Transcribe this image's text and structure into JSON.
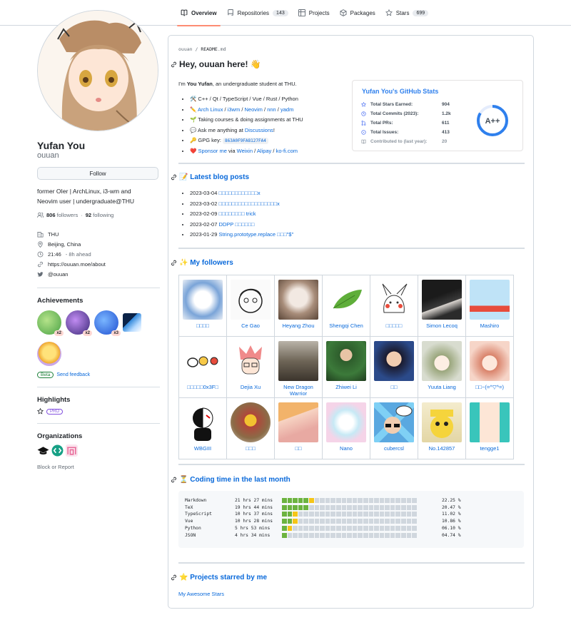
{
  "nav": {
    "tabs": [
      {
        "label": "Overview",
        "icon": "book-icon",
        "active": true
      },
      {
        "label": "Repositories",
        "icon": "repo-icon",
        "count": "143"
      },
      {
        "label": "Projects",
        "icon": "table-icon"
      },
      {
        "label": "Packages",
        "icon": "package-icon"
      },
      {
        "label": "Stars",
        "icon": "star-icon",
        "count": "699"
      }
    ]
  },
  "profile": {
    "name": "Yufan You",
    "login": "ouuan",
    "follow_label": "Follow",
    "bio_line1": "former OIer | ArchLinux, i3-wm and",
    "bio_line2": "Neovim user | undergraduate@THU",
    "followers_count": "806",
    "followers_label": "followers",
    "dot": "·",
    "following_count": "92",
    "following_label": "following",
    "org": "THU",
    "location": "Beijing, China",
    "time": "21:46",
    "time_note": "- 8h ahead",
    "website": "https://ouuan.moe/about",
    "twitter": "@ouuan"
  },
  "achievements": {
    "title": "Achievements",
    "items": [
      {
        "icon": "pair-extraordinaire-icon",
        "mult": "x2"
      },
      {
        "icon": "galaxy-brain-icon",
        "mult": "x2"
      },
      {
        "icon": "pull-shark-icon",
        "mult": "x3"
      },
      {
        "icon": "arctic-code-vault-icon",
        "mult": ""
      },
      {
        "icon": "quickdraw-icon",
        "mult": ""
      }
    ],
    "beta_label": "Beta",
    "feedback_label": "Send feedback"
  },
  "highlights": {
    "title": "Highlights",
    "pro_label": "PRO"
  },
  "organizations": {
    "title": "Organizations"
  },
  "block_label": "Block or Report",
  "readme": {
    "crumb_user": "ouuan",
    "crumb_sep": " / ",
    "crumb_file": "README",
    "crumb_ext": ".md",
    "greeting": "Hey, ouuan here! 👋",
    "intro_pre": "I'm ",
    "intro_name": "You Yufan",
    "intro_post": ", an undergraduate student at THU.",
    "bullets": {
      "langs": "🛠️ C++ / Qt / TypeScript / Vue / Rust / Python",
      "tools_prefix": "✏️",
      "tools": [
        "Arch Linux",
        "i3wm",
        "Neovim",
        "nnn",
        "yadm"
      ],
      "courses": "🌱 Taking courses & doing assignments at THU",
      "ask_pre": "💬 Ask me anything at ",
      "ask_link": "Discussions",
      "ask_post": "!",
      "gpg_label": "🔑 GPG key: ",
      "gpg_key": "863A0F9FA8127FA4",
      "sponsor_prefix": "❤️",
      "sponsor_link": "Sponsor me",
      "sponsor_via": " via ",
      "sponsor_methods": [
        "Weixin",
        "Alipay",
        "ko-fi.com"
      ]
    },
    "blog_title": "📝 Latest blog posts",
    "blog_posts": [
      {
        "date": "2023-03-04",
        "title": "□□□□□□□□□□□□x"
      },
      {
        "date": "2023-03-02",
        "title": "□□□□□□□□□□□□□□□□□□x"
      },
      {
        "date": "2023-02-09",
        "title": "□□□□□□□□ trick"
      },
      {
        "date": "2023-02-07",
        "title": "DDPP □□□□□□"
      },
      {
        "date": "2023-01-29",
        "title": "String.prototype.replace □□□\"$\""
      }
    ],
    "followers_title": "✨ My followers",
    "followers": [
      [
        "□□□□",
        "Ce Gao",
        "Heyang Zhou",
        "Shengqi Chen",
        "□□□□□",
        "Simon Lecoq",
        "Mashiro"
      ],
      [
        "□□□□□0x3F□",
        "Dejia Xu",
        "New Dragon Warrior",
        "Zhiwei Li",
        "□□",
        "Yuuta Liang",
        "□□~(=^▽^=)"
      ],
      [
        "WBGIII",
        "□□□",
        "□□",
        "Nano",
        "cubercsl",
        "No.142857",
        "tengge1"
      ]
    ],
    "coding_title": "⏳ Coding time in the last month",
    "coding": [
      {
        "lang": "Markdown",
        "time": "21 hrs 27 mins",
        "pct": "22.25 %",
        "fraction": 0.2225
      },
      {
        "lang": "TeX",
        "time": "19 hrs 44 mins",
        "pct": "20.47 %",
        "fraction": 0.2047
      },
      {
        "lang": "TypeScript",
        "time": "10 hrs 37 mins",
        "pct": "11.02 %",
        "fraction": 0.1102
      },
      {
        "lang": "Vue",
        "time": "10 hrs 28 mins",
        "pct": "10.86 %",
        "fraction": 0.1086
      },
      {
        "lang": "Python",
        "time": "5 hrs 53 mins",
        "pct": "06.10 %",
        "fraction": 0.061
      },
      {
        "lang": "JSON",
        "time": "4 hrs 34 mins",
        "pct": "04.74 %",
        "fraction": 0.0474
      }
    ],
    "starred_title": "⭐ Projects starred by me",
    "starred_link": "My Awesome Stars"
  },
  "stats_card": {
    "title": "Yufan You's GitHub Stats",
    "rows": [
      {
        "label": "Total Stars Earned:",
        "value": "904",
        "icon": "star-icon"
      },
      {
        "label": "Total Commits (2023):",
        "value": "1.2k",
        "icon": "clock-icon"
      },
      {
        "label": "Total PRs:",
        "value": "611",
        "icon": "pr-icon"
      },
      {
        "label": "Total Issues:",
        "value": "413",
        "icon": "issue-icon"
      },
      {
        "label": "Contributed to (last year):",
        "value": "20",
        "icon": "book-icon"
      }
    ],
    "grade": "A++",
    "accent": "#2f80ed"
  }
}
